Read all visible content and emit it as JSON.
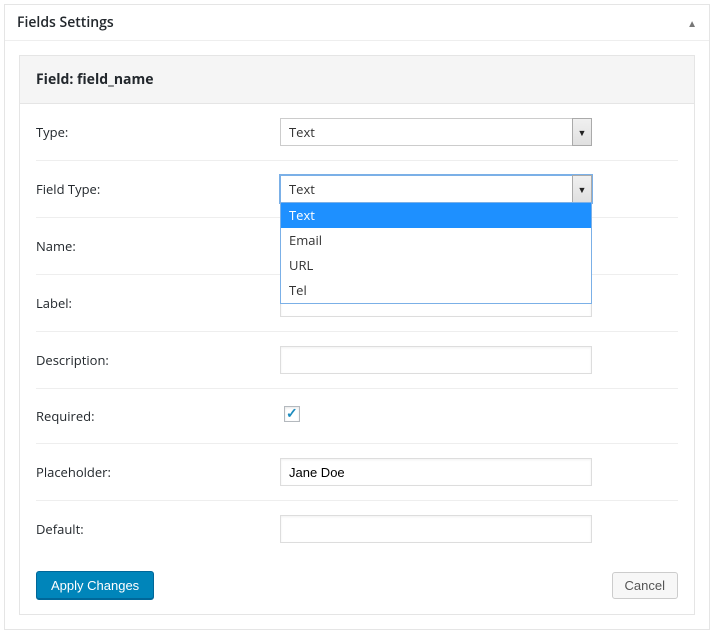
{
  "panel": {
    "title": "Fields Settings"
  },
  "card": {
    "title": "Field: field_name"
  },
  "rows": {
    "type": {
      "label": "Type:",
      "value": "Text"
    },
    "field_type": {
      "label": "Field Type:",
      "value": "Text",
      "options": [
        "Text",
        "Email",
        "URL",
        "Tel"
      ]
    },
    "name": {
      "label": "Name:",
      "value": ""
    },
    "label_row": {
      "label": "Label:",
      "value": ""
    },
    "description": {
      "label": "Description:",
      "value": ""
    },
    "required": {
      "label": "Required:",
      "checked": true
    },
    "placeholder": {
      "label": "Placeholder:",
      "value": "Jane Doe"
    },
    "default": {
      "label": "Default:",
      "value": ""
    }
  },
  "footer": {
    "apply": "Apply Changes",
    "cancel": "Cancel"
  }
}
